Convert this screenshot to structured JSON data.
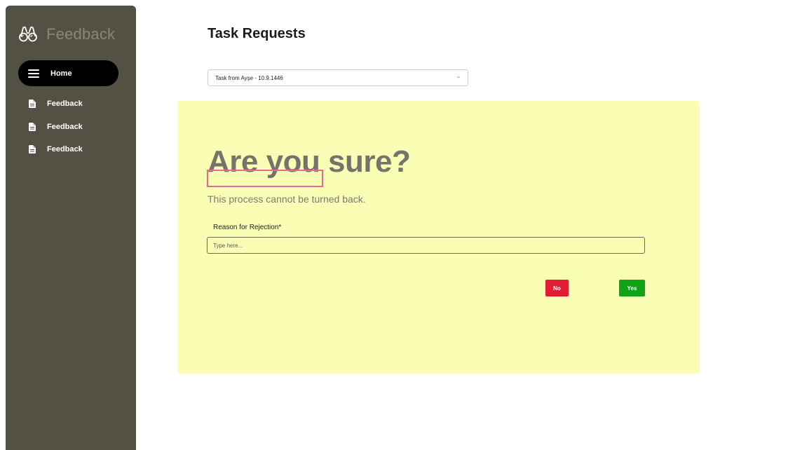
{
  "sidebar": {
    "brand_label": "Feedback",
    "home_label": "Home",
    "items": [
      {
        "label": "Feedback",
        "icon": "document-icon"
      },
      {
        "label": "Feedback",
        "icon": "document-icon"
      },
      {
        "label": "Feedback",
        "icon": "document-icon"
      }
    ]
  },
  "main": {
    "title": "Task Requests",
    "task_select": {
      "value": "Task from Ayşe - 10.9.1446"
    }
  },
  "modal": {
    "title": "Are you sure?",
    "message": "This process cannot be turned back.",
    "reason_label": "Reason for Rejection*",
    "reason_placeholder": "Type here...",
    "no_label": "No",
    "yes_label": "Yes"
  },
  "colors": {
    "sidebar_bg": "#535044",
    "modal_bg": "#fafeb5",
    "no_button": "#e11d36",
    "yes_button": "#10a318",
    "highlight": "#e06a98"
  }
}
